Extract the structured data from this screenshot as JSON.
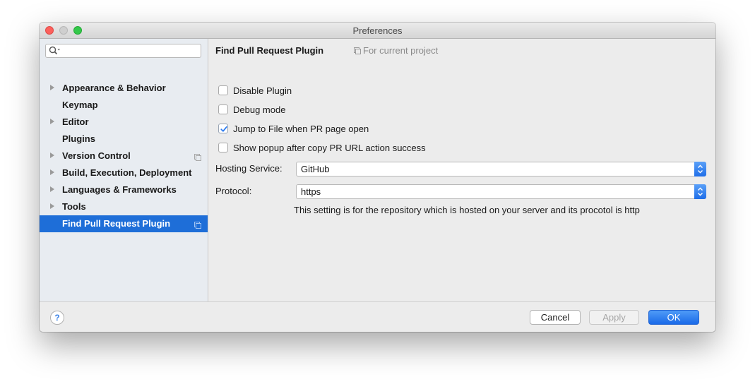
{
  "window": {
    "title": "Preferences"
  },
  "search": {
    "placeholder": "",
    "value": ""
  },
  "sidebar": {
    "items": [
      {
        "label": "Appearance & Behavior",
        "expandable": true,
        "project_scoped": false,
        "selected": false
      },
      {
        "label": "Keymap",
        "expandable": false,
        "project_scoped": false,
        "selected": false
      },
      {
        "label": "Editor",
        "expandable": true,
        "project_scoped": false,
        "selected": false
      },
      {
        "label": "Plugins",
        "expandable": false,
        "project_scoped": false,
        "selected": false
      },
      {
        "label": "Version Control",
        "expandable": true,
        "project_scoped": true,
        "selected": false
      },
      {
        "label": "Build, Execution, Deployment",
        "expandable": true,
        "project_scoped": false,
        "selected": false
      },
      {
        "label": "Languages & Frameworks",
        "expandable": true,
        "project_scoped": false,
        "selected": false
      },
      {
        "label": "Tools",
        "expandable": true,
        "project_scoped": false,
        "selected": false
      },
      {
        "label": "Find Pull Request Plugin",
        "expandable": false,
        "project_scoped": true,
        "selected": true
      }
    ]
  },
  "content": {
    "title": "Find Pull Request Plugin",
    "scope_label": "For current project",
    "checkboxes": [
      {
        "label": "Disable Plugin",
        "checked": false
      },
      {
        "label": "Debug mode",
        "checked": false
      },
      {
        "label": "Jump to File when PR page open",
        "checked": true
      },
      {
        "label": "Show popup after copy PR URL action success",
        "checked": false
      }
    ],
    "hosting_service": {
      "label": "Hosting Service:",
      "value": "GitHub"
    },
    "protocol": {
      "label": "Protocol:",
      "value": "https"
    },
    "hint": "This setting is for the repository which is hosted on your server and its procotol is http"
  },
  "footer": {
    "help_label": "?",
    "cancel_label": "Cancel",
    "apply_label": "Apply",
    "ok_label": "OK"
  },
  "colors": {
    "selection": "#1e6ed8",
    "sidebar_bg": "#e8ecf1",
    "accent": "#2d7cf0"
  },
  "icons": {
    "search": "search-icon",
    "project": "project-scope-icon",
    "checkmark": "checkmark-icon",
    "stepper": "up-down-stepper-icon"
  }
}
